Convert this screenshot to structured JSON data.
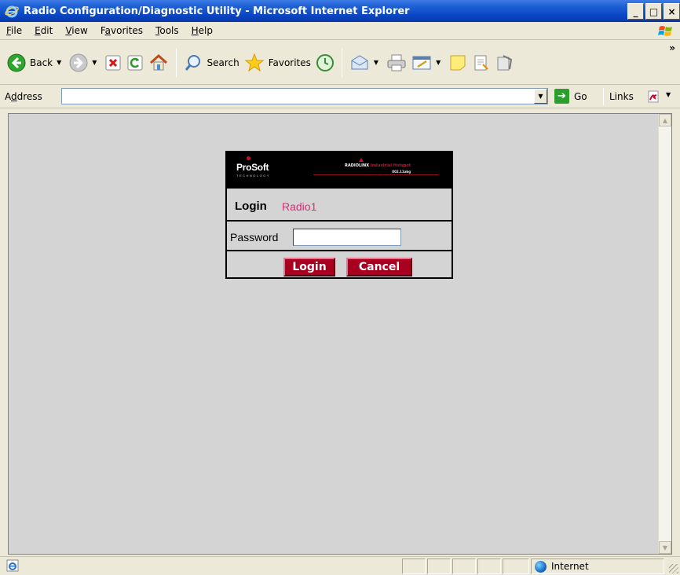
{
  "window": {
    "title": "Radio Configuration/Diagnostic Utility - Microsoft Internet Explorer",
    "controls": {
      "minimize": "_",
      "maximize": "□",
      "close": "×"
    }
  },
  "menu": {
    "items": [
      {
        "key": "F",
        "rest": "ile"
      },
      {
        "key": "E",
        "rest": "dit"
      },
      {
        "key": "V",
        "rest": "iew"
      },
      {
        "pre": "F",
        "key": "a",
        "rest": "vorites"
      },
      {
        "key": "T",
        "rest": "ools"
      },
      {
        "key": "H",
        "rest": "elp"
      }
    ]
  },
  "toolbar": {
    "back_label": "Back",
    "search_label": "Search",
    "favorites_label": "Favorites",
    "more": "»"
  },
  "address": {
    "label_key": "d",
    "label_pre": "A",
    "label_rest": "dress",
    "value": "",
    "go_label": "Go",
    "links_label": "Links"
  },
  "login_panel": {
    "prosoft_logo": "ProSoft",
    "prosoft_sub": "TECHNOLOGY",
    "radiolinx_logo": "RADIOLINX",
    "radiolinx_hotspot": "Industrial Hotspot",
    "radiolinx_std": "802.11abg",
    "title": "Login",
    "radio_name": "Radio1",
    "password_label": "Password",
    "password_value": "",
    "login_button": "Login",
    "cancel_button": "Cancel"
  },
  "status": {
    "text": "",
    "zone": "Internet"
  },
  "colors": {
    "titlebar": "#0a46c4",
    "chrome": "#ece9d8",
    "content_bg": "#d4d4d4",
    "button_red": "#a8001e",
    "radio_name_pink": "#e0287a"
  }
}
